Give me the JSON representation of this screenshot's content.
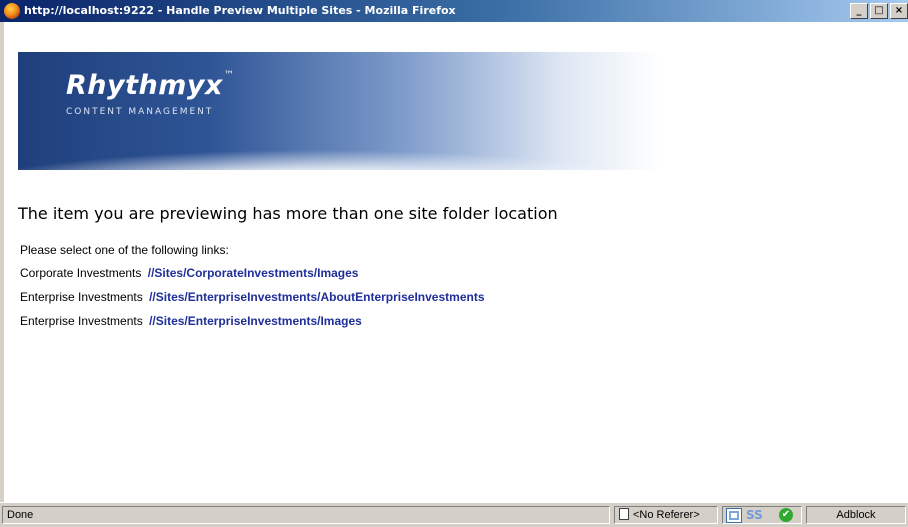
{
  "window": {
    "title": "http://localhost:9222 - Handle Preview Multiple Sites - Mozilla Firefox",
    "buttons": {
      "minimize": "_",
      "maximize": "□",
      "close": "×"
    }
  },
  "banner": {
    "logo": "Rhythmyx",
    "trademark": "™",
    "subtitle": "CONTENT MANAGEMENT"
  },
  "page": {
    "heading": "The item you are previewing has more than one site folder location",
    "prompt": "Please select one of the following links:",
    "links": [
      {
        "site": "Corporate Investments",
        "path": "//Sites/CorporateInvestments/Images"
      },
      {
        "site": "Enterprise Investments",
        "path": "//Sites/EnterpriseInvestments/AboutEnterpriseInvestments"
      },
      {
        "site": "Enterprise Investments",
        "path": "//Sites/EnterpriseInvestments/Images"
      }
    ]
  },
  "statusbar": {
    "status": "Done",
    "referer": "<No Referer>",
    "ss_label": "SS",
    "check": "✔",
    "adblock": "Adblock"
  },
  "icons": [
    "firefox-icon",
    "page-icon",
    "grid-icon",
    "ss-icon",
    "check-icon"
  ]
}
